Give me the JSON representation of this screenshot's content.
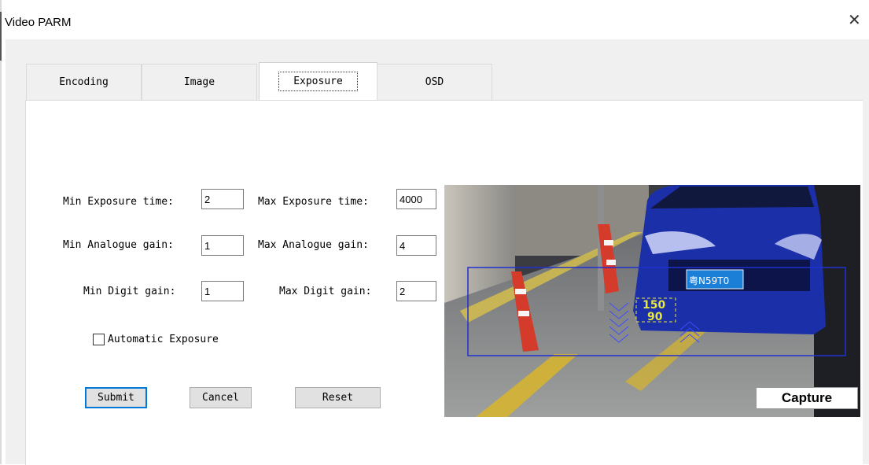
{
  "window": {
    "title": "Video PARM",
    "close_glyph": "✕"
  },
  "tabs": [
    {
      "label": "Encoding",
      "active": false
    },
    {
      "label": "Image",
      "active": false
    },
    {
      "label": "Exposure",
      "active": true
    },
    {
      "label": "OSD",
      "active": false
    }
  ],
  "exposure": {
    "min_exposure_label": "Min Exposure time:",
    "min_exposure_value": "2",
    "max_exposure_label": "Max Exposure time:",
    "max_exposure_value": "4000",
    "min_analogue_label": "Min Analogue gain:",
    "min_analogue_value": "1",
    "max_analogue_label": "Max Analogue gain:",
    "max_analogue_value": "4",
    "min_digit_label": "Min Digit gain:",
    "min_digit_value": "1",
    "max_digit_label": "Max Digit gain:",
    "max_digit_value": "2",
    "auto_exposure_label": "Automatic Exposure",
    "auto_exposure_checked": false
  },
  "buttons": {
    "submit": "Submit",
    "cancel": "Cancel",
    "reset": "Reset"
  },
  "preview": {
    "capture_label": "Capture",
    "plate_text": "粤N59T0",
    "overlay_top": "150",
    "overlay_bottom": "90",
    "overlay_color": "#e8e83a",
    "roi_color": "#2030d0"
  }
}
